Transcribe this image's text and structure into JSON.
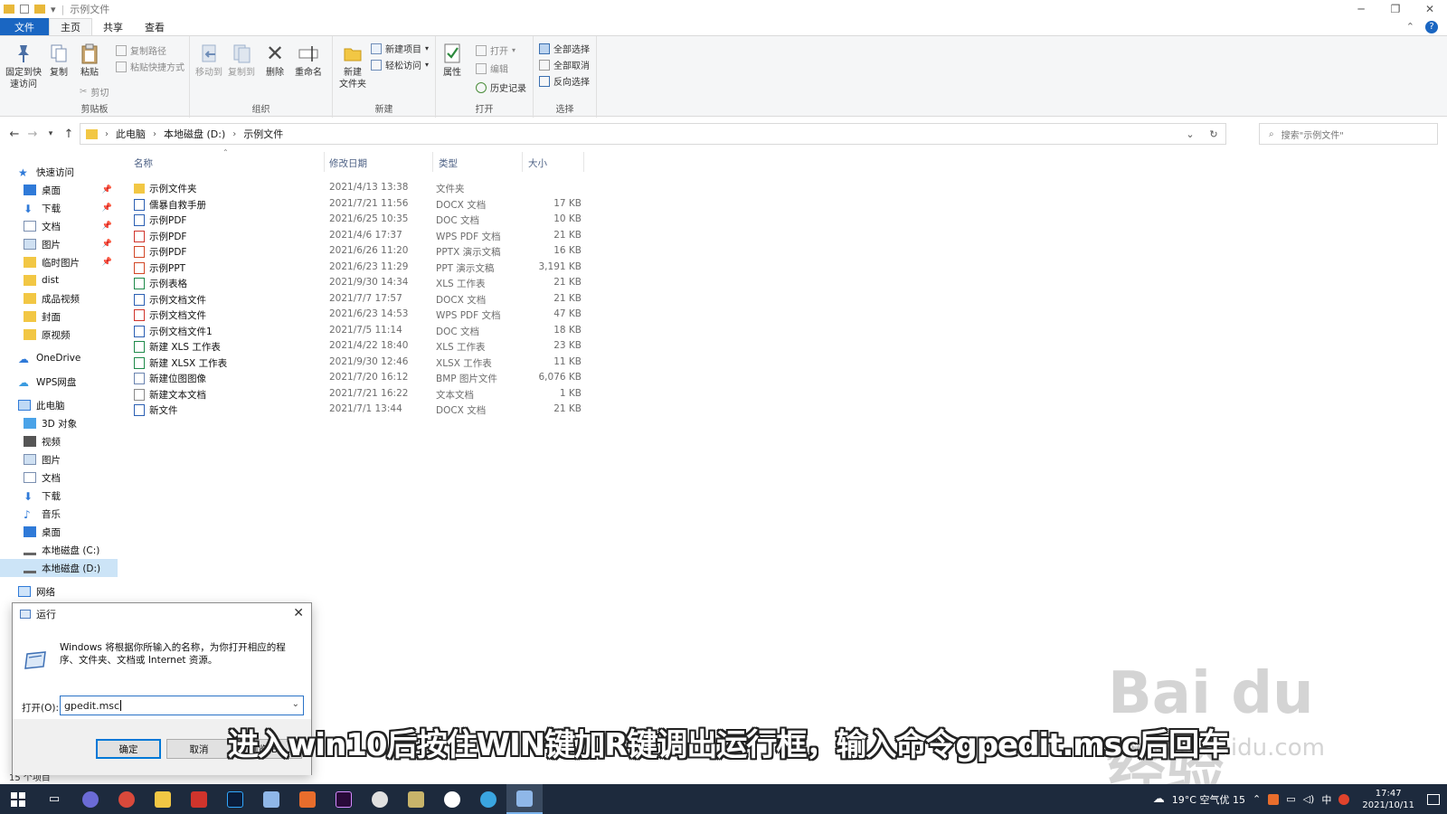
{
  "window": {
    "title": "示例文件",
    "controls": [
      "minimize-icon",
      "restore-icon",
      "close-icon"
    ]
  },
  "ribbon_tabs": [
    "文件",
    "主页",
    "共享",
    "查看"
  ],
  "ribbon": {
    "clipboard": {
      "pin_label": "固定到快\n速访问",
      "copy_label": "复制",
      "paste_label": "粘贴",
      "copy_path": "复制路径",
      "paste_shortcut": "粘贴快捷方式",
      "cut": "剪切",
      "group_name": "剪贴板"
    },
    "organize": {
      "move_to": "移动到",
      "copy_to": "复制到",
      "delete": "删除",
      "rename": "重命名",
      "group_name": "组织"
    },
    "new": {
      "new_folder": "新建\n文件夹",
      "new_item": "新建项目",
      "easy_access": "轻松访问",
      "group_name": "新建"
    },
    "open": {
      "properties": "属性",
      "open": "打开",
      "edit": "编辑",
      "history": "历史记录",
      "group_name": "打开"
    },
    "select": {
      "select_all": "全部选择",
      "select_none": "全部取消",
      "invert": "反向选择",
      "group_name": "选择"
    }
  },
  "address": {
    "crumbs": [
      "此电脑",
      "本地磁盘 (D:)",
      "示例文件"
    ],
    "search_placeholder": "搜索\"示例文件\""
  },
  "nav": {
    "quick_access": "快速访问",
    "quick_items": [
      "桌面",
      "下载",
      "文档",
      "图片",
      "临时图片",
      "dist",
      "成品视频",
      "封面",
      "原视频"
    ],
    "onedrive": "OneDrive",
    "wps": "WPS网盘",
    "this_pc": "此电脑",
    "pc_items": [
      "3D 对象",
      "视频",
      "图片",
      "文档",
      "下载",
      "音乐",
      "桌面",
      "本地磁盘 (C:)",
      "本地磁盘 (D:)"
    ],
    "network": "网络"
  },
  "columns": {
    "name": "名称",
    "date": "修改日期",
    "type": "类型",
    "size": "大小"
  },
  "files": [
    {
      "name": "示例文件夹",
      "date": "2021/4/13 13:38",
      "type": "文件夹",
      "size": "",
      "icon": "folder-icon"
    },
    {
      "name": "儒暴自救手册",
      "date": "2021/7/21 11:56",
      "type": "DOCX 文档",
      "size": "17 KB",
      "icon": "docx-icon"
    },
    {
      "name": "示例PDF",
      "date": "2021/6/25 10:35",
      "type": "DOC 文档",
      "size": "10 KB",
      "icon": "doc-icon"
    },
    {
      "name": "示例PDF",
      "date": "2021/4/6 17:37",
      "type": "WPS PDF 文档",
      "size": "21 KB",
      "icon": "pdf-icon"
    },
    {
      "name": "示例PDF",
      "date": "2021/6/26 11:20",
      "type": "PPTX 演示文稿",
      "size": "16 KB",
      "icon": "pptx-icon"
    },
    {
      "name": "示例PPT",
      "date": "2021/6/23 11:29",
      "type": "PPT 演示文稿",
      "size": "3,191 KB",
      "icon": "ppt-icon"
    },
    {
      "name": "示例表格",
      "date": "2021/9/30 14:34",
      "type": "XLS 工作表",
      "size": "21 KB",
      "icon": "xls-icon"
    },
    {
      "name": "示例文档文件",
      "date": "2021/7/7 17:57",
      "type": "DOCX 文档",
      "size": "21 KB",
      "icon": "docx-icon"
    },
    {
      "name": "示例文档文件",
      "date": "2021/6/23 14:53",
      "type": "WPS PDF 文档",
      "size": "47 KB",
      "icon": "pdf-icon"
    },
    {
      "name": "示例文档文件1",
      "date": "2021/7/5 11:14",
      "type": "DOC 文档",
      "size": "18 KB",
      "icon": "doc-icon"
    },
    {
      "name": "新建 XLS 工作表",
      "date": "2021/4/22 18:40",
      "type": "XLS 工作表",
      "size": "23 KB",
      "icon": "xls-icon"
    },
    {
      "name": "新建 XLSX 工作表",
      "date": "2021/9/30 12:46",
      "type": "XLSX 工作表",
      "size": "11 KB",
      "icon": "xlsx-icon"
    },
    {
      "name": "新建位图图像",
      "date": "2021/7/20 16:12",
      "type": "BMP 图片文件",
      "size": "6,076 KB",
      "icon": "bmp-icon"
    },
    {
      "name": "新建文本文档",
      "date": "2021/7/21 16:22",
      "type": "文本文档",
      "size": "1 KB",
      "icon": "txt-icon"
    },
    {
      "name": "新文件",
      "date": "2021/7/1 13:44",
      "type": "DOCX 文档",
      "size": "21 KB",
      "icon": "docx-icon"
    }
  ],
  "status": "15 个项目",
  "run_dialog": {
    "title": "运行",
    "description": "Windows 将根据你所输入的名称，为你打开相应的程序、文件夹、文档或 Internet 资源。",
    "open_label": "打开(O):",
    "input_value": "gpedit.msc",
    "ok": "确定",
    "cancel": "取消",
    "browse": "浏览(B)..."
  },
  "subtitle": "进入win10后按住WIN键加R键调出运行框，输入命令gpedit.msc后回车",
  "watermark": {
    "main": "Bai du 经验",
    "sub": "jingyan.baidu.com"
  },
  "taskbar": {
    "weather": "19°C 空气优 15",
    "ime": "中",
    "time": "17:47",
    "date": "2021/10/11"
  }
}
